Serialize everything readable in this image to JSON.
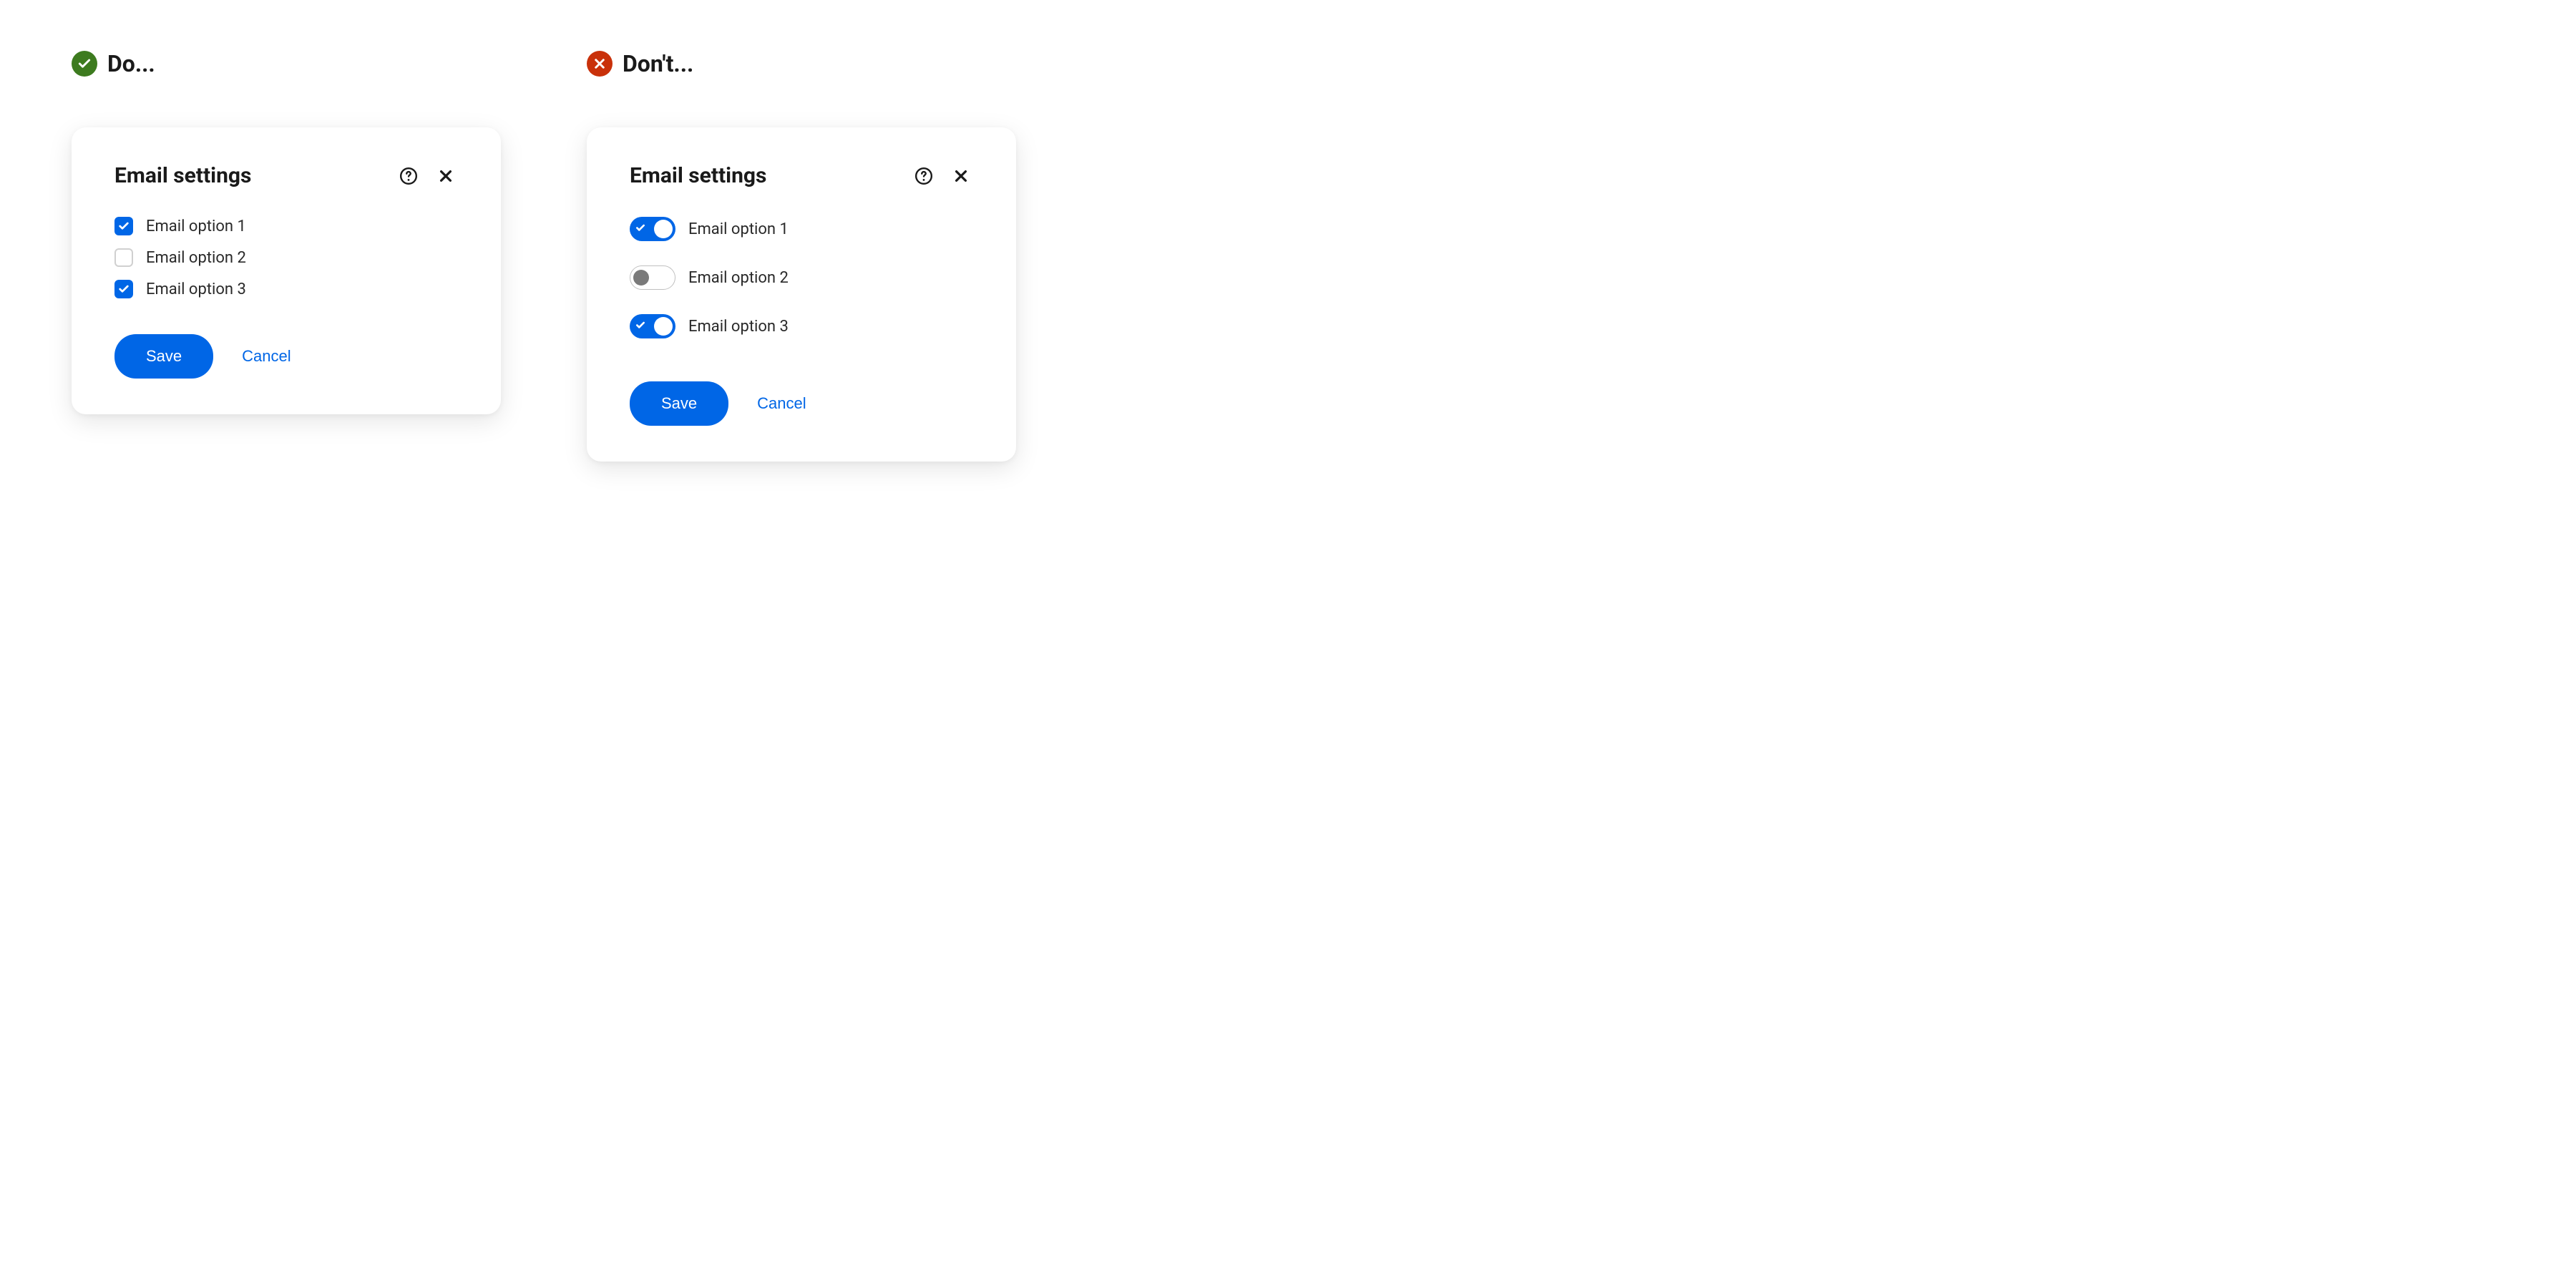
{
  "do": {
    "heading": "Do...",
    "card": {
      "title": "Email settings",
      "options": [
        {
          "label": "Email option 1",
          "checked": true
        },
        {
          "label": "Email option 2",
          "checked": false
        },
        {
          "label": "Email option 3",
          "checked": true
        }
      ],
      "save_label": "Save",
      "cancel_label": "Cancel"
    }
  },
  "dont": {
    "heading": "Don't...",
    "card": {
      "title": "Email settings",
      "options": [
        {
          "label": "Email option 1",
          "on": true
        },
        {
          "label": "Email option 2",
          "on": false
        },
        {
          "label": "Email option 3",
          "on": true
        }
      ],
      "save_label": "Save",
      "cancel_label": "Cancel"
    }
  },
  "colors": {
    "primary": "#0066e6",
    "do_badge": "#3d7b1f",
    "dont_badge": "#c9310a"
  }
}
